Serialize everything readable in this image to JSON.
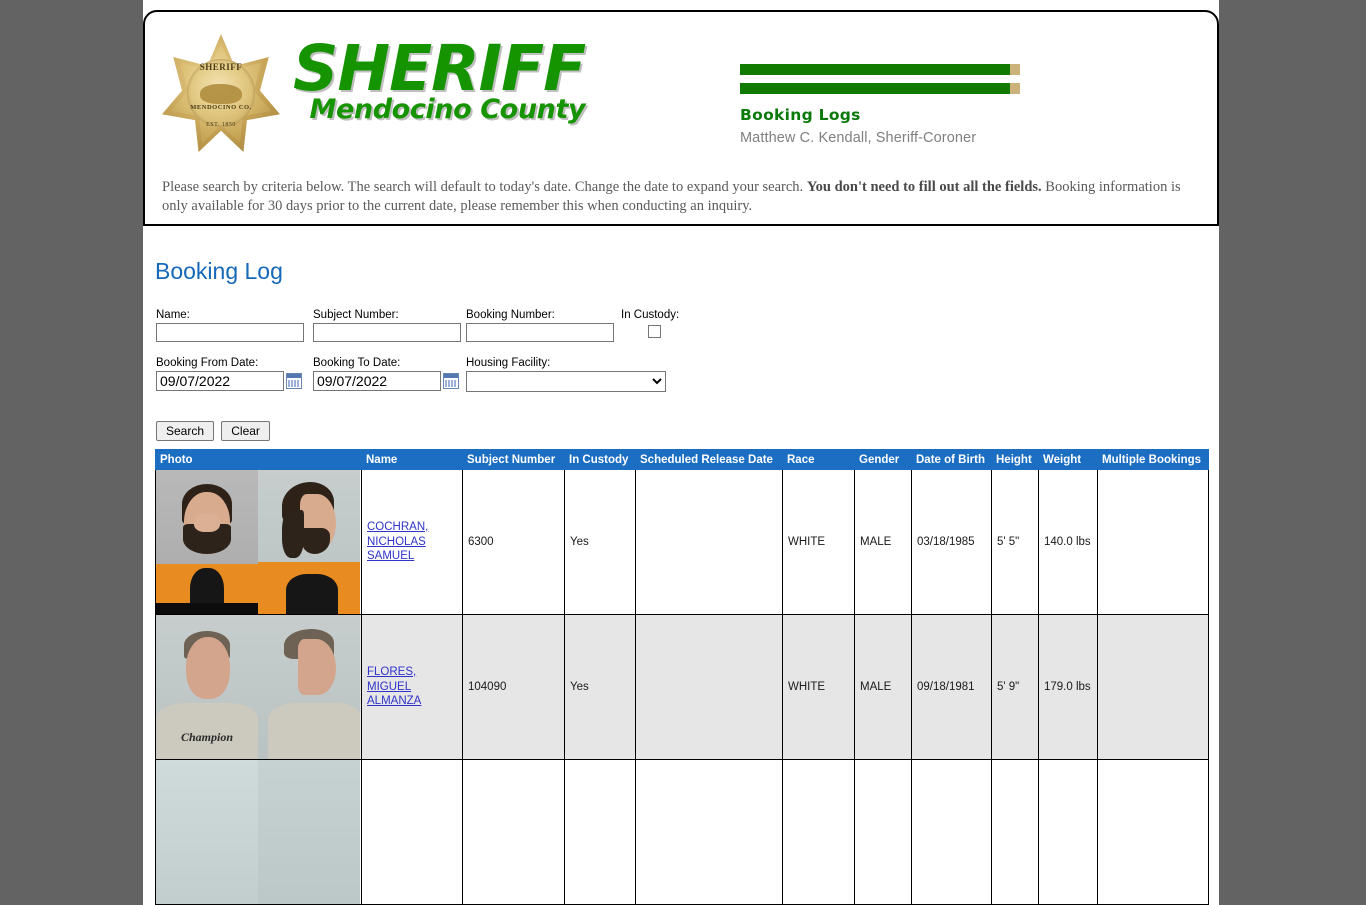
{
  "masthead": {
    "badge": {
      "line1": "SHERIFF",
      "line2": "MENDOCINO CO.",
      "line3": "EST. 1850"
    },
    "wordmark_main": "SHERIFF",
    "wordmark_sub": "Mendocino County",
    "section_title": "Booking Logs",
    "official_name": "Matthew C. Kendall, Sheriff-Coroner",
    "instructions_part1": "Please search by criteria below. The search will default to today's date. Change the date to expand your search. ",
    "instructions_bold": "You don't need to fill out all the fields.",
    "instructions_part2": " Booking information is only available for 30 days prior to the current date, please remember this when conducting an inquiry."
  },
  "page": {
    "title": "Booking Log",
    "title_color": "#1668b8",
    "header_color": "#1b6ec2",
    "link_color": "#2f33c9"
  },
  "search_form": {
    "name_label": "Name:",
    "name_value": "",
    "subject_number_label": "Subject Number:",
    "subject_number_value": "",
    "booking_number_label": "Booking Number:",
    "booking_number_value": "",
    "in_custody_label": "In Custody:",
    "in_custody_checked": false,
    "booking_from_label": "Booking From Date:",
    "booking_from_value": "09/07/2022",
    "booking_to_label": "Booking To Date:",
    "booking_to_value": "09/07/2022",
    "housing_facility_label": "Housing Facility:",
    "housing_facility_value": "",
    "housing_facility_options": [
      ""
    ],
    "search_button": "Search",
    "clear_button": "Clear",
    "calendar_icon": "calendar-icon",
    "dropdown_icon": "chevron-down-icon"
  },
  "results_table": {
    "columns": [
      "Photo",
      "Name",
      "Subject Number",
      "In Custody",
      "Scheduled Release Date",
      "Race",
      "Gender",
      "Date of Birth",
      "Height",
      "Weight",
      "Multiple Bookings"
    ],
    "rows": [
      {
        "name": "COCHRAN, NICHOLAS SAMUEL",
        "subject_number": "6300",
        "in_custody": "Yes",
        "scheduled_release_date": "",
        "race": "WHITE",
        "gender": "MALE",
        "date_of_birth": "03/18/1985",
        "height": "5' 5\"",
        "weight": "140.0 lbs",
        "multiple_bookings": ""
      },
      {
        "name": "FLORES, MIGUEL ALMANZA",
        "subject_number": "104090",
        "in_custody": "Yes",
        "scheduled_release_date": "",
        "race": "WHITE",
        "gender": "MALE",
        "date_of_birth": "09/18/1981",
        "height": "5' 9\"",
        "weight": "179.0 lbs",
        "multiple_bookings": ""
      },
      {
        "name": "",
        "subject_number": "",
        "in_custody": "",
        "scheduled_release_date": "",
        "race": "",
        "gender": "",
        "date_of_birth": "",
        "height": "",
        "weight": "",
        "multiple_bookings": ""
      }
    ]
  }
}
